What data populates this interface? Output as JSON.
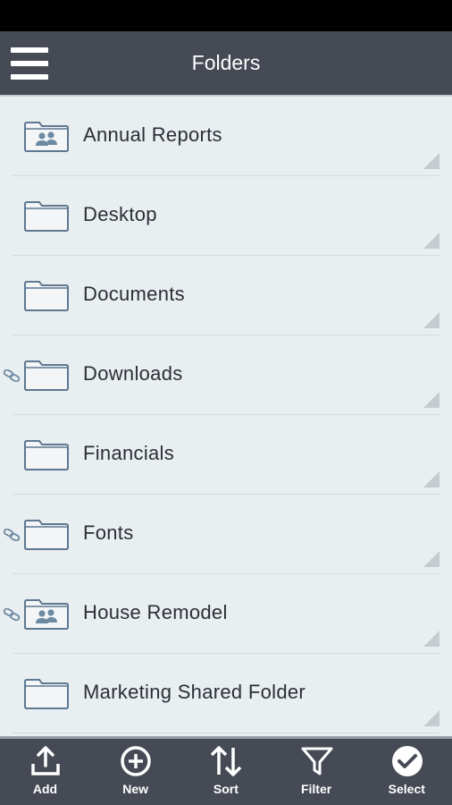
{
  "header": {
    "title": "Folders",
    "menu_icon": "hamburger-menu-icon"
  },
  "folders": [
    {
      "label": "Annual Reports",
      "icon": "shared-folder-icon",
      "linked": false
    },
    {
      "label": "Desktop",
      "icon": "folder-icon",
      "linked": false
    },
    {
      "label": "Documents",
      "icon": "folder-icon",
      "linked": false
    },
    {
      "label": "Downloads",
      "icon": "folder-icon",
      "linked": true
    },
    {
      "label": "Financials",
      "icon": "folder-icon",
      "linked": false
    },
    {
      "label": "Fonts",
      "icon": "folder-icon",
      "linked": true
    },
    {
      "label": "House Remodel",
      "icon": "shared-folder-icon",
      "linked": true
    },
    {
      "label": "Marketing Shared Folder",
      "icon": "folder-icon",
      "linked": false
    }
  ],
  "toolbar": [
    {
      "label": "Add",
      "icon": "upload-icon"
    },
    {
      "label": "New",
      "icon": "plus-circle-icon"
    },
    {
      "label": "Sort",
      "icon": "sort-icon"
    },
    {
      "label": "Filter",
      "icon": "filter-icon"
    },
    {
      "label": "Select",
      "icon": "check-circle-icon"
    }
  ],
  "colors": {
    "app_bar": "#464a55",
    "list_background": "#e9eef1",
    "folder_stroke": "#5d7890",
    "text": "#2b2f36"
  }
}
